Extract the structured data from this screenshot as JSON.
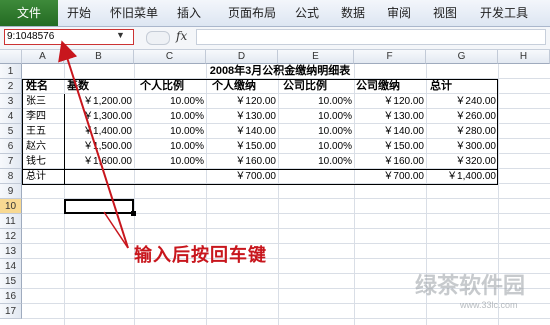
{
  "ribbon": {
    "tabs": [
      "文件",
      "开始",
      "怀旧菜单",
      "插入",
      "页面布局",
      "公式",
      "数据",
      "审阅",
      "视图",
      "开发工具"
    ]
  },
  "formula_bar": {
    "name_box": "9:1048576",
    "fx_label": "fx",
    "value": ""
  },
  "grid": {
    "columns": [
      "A",
      "B",
      "C",
      "D",
      "E",
      "F",
      "G",
      "H"
    ],
    "rows": [
      "1",
      "2",
      "3",
      "4",
      "5",
      "6",
      "7",
      "8",
      "9",
      "10",
      "11",
      "12",
      "13",
      "14",
      "15",
      "16",
      "17"
    ],
    "selected_row": "10",
    "title": "2008年3月公积金缴纳明细表",
    "headers": [
      "姓名",
      "基数",
      "个人比例",
      "个人缴纳",
      "公司比例",
      "公司缴纳",
      "总计"
    ],
    "data": [
      [
        "张三",
        "￥1,200.00",
        "10.00%",
        "￥120.00",
        "10.00%",
        "￥120.00",
        "￥240.00"
      ],
      [
        "李四",
        "￥1,300.00",
        "10.00%",
        "￥130.00",
        "10.00%",
        "￥130.00",
        "￥260.00"
      ],
      [
        "王五",
        "￥1,400.00",
        "10.00%",
        "￥140.00",
        "10.00%",
        "￥140.00",
        "￥280.00"
      ],
      [
        "赵六",
        "￥1,500.00",
        "10.00%",
        "￥150.00",
        "10.00%",
        "￥150.00",
        "￥300.00"
      ],
      [
        "钱七",
        "￥1,600.00",
        "10.00%",
        "￥160.00",
        "10.00%",
        "￥160.00",
        "￥320.00"
      ]
    ],
    "total_row": [
      "总计",
      "",
      "",
      "￥700.00",
      "",
      "￥700.00",
      "￥1,400.00"
    ]
  },
  "annotation": "输入后按回车键",
  "watermark": {
    "text": "绿茶软件园",
    "url": "www.33lc.com"
  },
  "colors": {
    "file_tab": "#2e7d32",
    "annotation": "#c8161d",
    "selected_row_header": "#f8d992"
  }
}
